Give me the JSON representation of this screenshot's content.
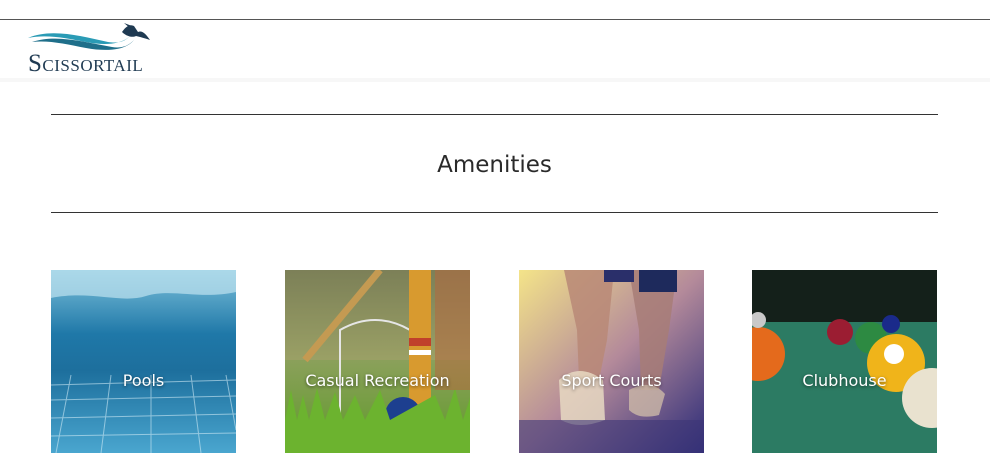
{
  "brand": {
    "logo_initial": "S",
    "logo_rest": "CISSORTAIL"
  },
  "section": {
    "title": "Amenities"
  },
  "amenities": [
    {
      "label": "Pools"
    },
    {
      "label": "Casual Recreation"
    },
    {
      "label": "Sport Courts"
    },
    {
      "label": "Clubhouse"
    }
  ],
  "colors": {
    "brand_navy": "#1f3a52",
    "brand_teal": "#2a9bb5",
    "rule": "#333333"
  }
}
